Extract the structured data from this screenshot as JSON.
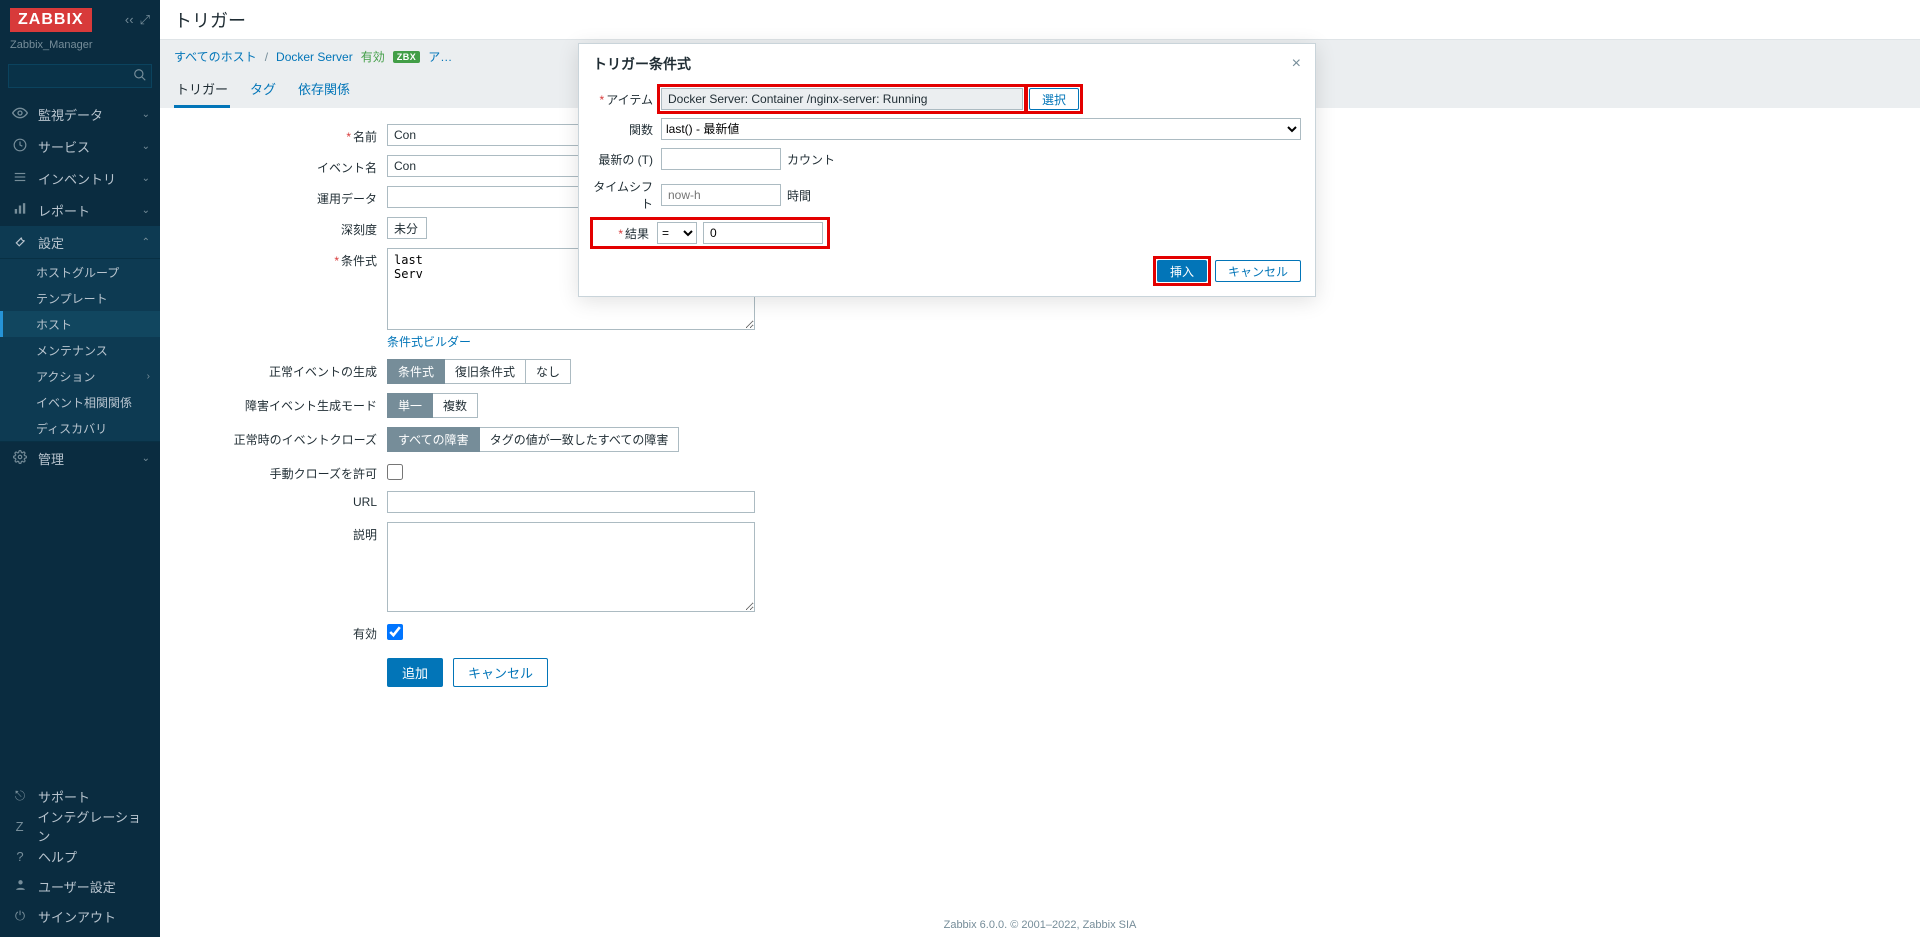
{
  "sidebar": {
    "logo": "ZABBIX",
    "subtitle": "Zabbix_Manager",
    "search_placeholder": "",
    "nav": {
      "monitoring": "監視データ",
      "services": "サービス",
      "inventory": "インベントリ",
      "reports": "レポート",
      "config": "設定",
      "config_sub": {
        "hostgroups": "ホストグループ",
        "templates": "テンプレート",
        "hosts": "ホスト",
        "maintenance": "メンテナンス",
        "actions": "アクション",
        "correlation": "イベント相関関係",
        "discovery": "ディスカバリ"
      },
      "admin": "管理"
    },
    "footer": {
      "support": "サポート",
      "integration": "インテグレーション",
      "help": "ヘルプ",
      "usersettings": "ユーザー設定",
      "signout": "サインアウト"
    }
  },
  "page": {
    "title": "トリガー",
    "breadcrumbs": {
      "allhosts": "すべてのホスト",
      "host": "Docker Server",
      "status": "有効",
      "badge": "ZBX",
      "trail": "ア…"
    },
    "tabs": {
      "trigger": "トリガー",
      "tags": "タグ",
      "dependencies": "依存関係"
    }
  },
  "form": {
    "labels": {
      "name": "名前",
      "eventname": "イベント名",
      "opdata": "運用データ",
      "severity": "深刻度",
      "expr": "条件式",
      "builder": "条件式ビルダー",
      "okevent": "正常イベントの生成",
      "prob_gen_mode": "障害イベント生成モード",
      "okclose": "正常時のイベントクローズ",
      "manual": "手動クローズを許可",
      "url": "URL",
      "desc": "説明",
      "enabled": "有効"
    },
    "values": {
      "name": "Con",
      "eventname": "Con",
      "opdata": "",
      "severity": "未分",
      "expr": "last\nServ"
    },
    "seg_okevent": {
      "a": "条件式",
      "b": "復旧条件式",
      "c": "なし"
    },
    "seg_mode": {
      "a": "単一",
      "b": "複数"
    },
    "seg_close": {
      "a": "すべての障害",
      "b": "タグの値が一致したすべての障害"
    },
    "actions": {
      "add": "追加",
      "cancel": "キャンセル"
    }
  },
  "modal": {
    "title": "トリガー条件式",
    "labels": {
      "item": "アイテム",
      "func": "関数",
      "last": "最新の (T)",
      "count_suffix": "カウント",
      "timeshift": "タイムシフト",
      "time_suffix": "時間",
      "result": "結果"
    },
    "values": {
      "item": "Docker Server: Container /nginx-server: Running",
      "select_btn": "選択",
      "func": "last() - 最新値",
      "last_t": "",
      "timeshift_ph": "now-h",
      "operator": "=",
      "result": "0"
    },
    "actions": {
      "insert": "挿入",
      "cancel": "キャンセル"
    }
  },
  "footer": "Zabbix 6.0.0. © 2001–2022, Zabbix SIA"
}
